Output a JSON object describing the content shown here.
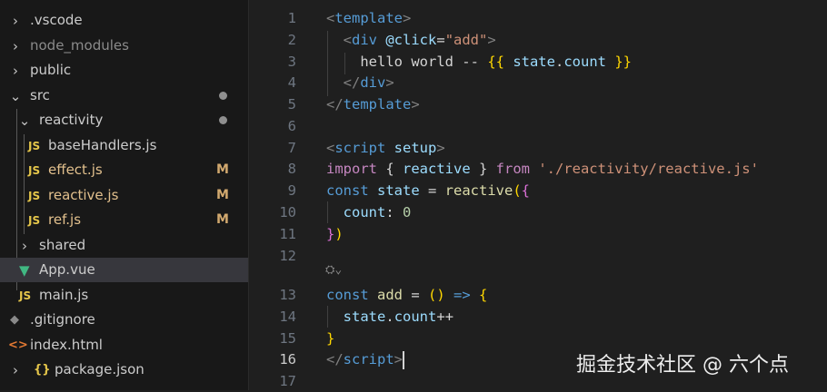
{
  "explorer": {
    "items": [
      {
        "label": ".vscode",
        "chevron": "›",
        "icon": ""
      },
      {
        "label": "node_modules",
        "chevron": "›",
        "icon": ""
      },
      {
        "label": "public",
        "chevron": "›",
        "icon": ""
      },
      {
        "label": "src",
        "chevron": "⌄",
        "icon": ""
      },
      {
        "label": "reactivity",
        "chevron": "⌄",
        "icon": ""
      },
      {
        "label": "baseHandlers.js",
        "icon": "JS"
      },
      {
        "label": "effect.js",
        "icon": "JS",
        "badge": "M"
      },
      {
        "label": "reactive.js",
        "icon": "JS",
        "badge": "M"
      },
      {
        "label": "ref.js",
        "icon": "JS",
        "badge": "M"
      },
      {
        "label": "shared",
        "chevron": "›",
        "icon": ""
      },
      {
        "label": "App.vue",
        "icon": "▼"
      },
      {
        "label": "main.js",
        "icon": "JS"
      },
      {
        "label": ".gitignore",
        "icon": "◆"
      },
      {
        "label": "index.html",
        "icon": "<>"
      },
      {
        "label": "package.json",
        "chevron": "›",
        "icon": "{}"
      }
    ]
  },
  "editor": {
    "line_numbers": [
      "1",
      "2",
      "3",
      "4",
      "5",
      "6",
      "7",
      "8",
      "9",
      "10",
      "11",
      "12",
      "13",
      "14",
      "15",
      "16",
      "17"
    ],
    "active_line": "16",
    "codelens": "⛭⌄",
    "lines": {
      "l1": {
        "a": "<",
        "b": "template",
        "c": ">"
      },
      "l2": {
        "a": "<",
        "b": "div",
        "c": " @click",
        "d": "=",
        "e": "\"add\"",
        "f": ">"
      },
      "l3": {
        "a": "hello world -- ",
        "b": "{{",
        "c": " state",
        "d": ".",
        "e": "count",
        "f": " }}"
      },
      "l4": {
        "a": "</",
        "b": "div",
        "c": ">"
      },
      "l5": {
        "a": "</",
        "b": "template",
        "c": ">"
      },
      "l7": {
        "a": "<",
        "b": "script",
        "c": " setup",
        "d": ">"
      },
      "l8": {
        "a": "import",
        "b": " { ",
        "c": "reactive",
        "d": " } ",
        "e": "from",
        "f": " './reactivity/reactive.js'"
      },
      "l9": {
        "a": "const",
        "b": " state",
        "c": " = ",
        "d": "reactive",
        "e": "(",
        "f": "{"
      },
      "l10": {
        "a": "count",
        "b": ": ",
        "c": "0"
      },
      "l11": {
        "a": "}",
        "b": ")"
      },
      "l13": {
        "a": "const",
        "b": " add",
        "c": " = ",
        "d": "()",
        "e": " => ",
        "f": "{"
      },
      "l14": {
        "a": "state",
        "b": ".",
        "c": "count",
        "d": "++"
      },
      "l15": {
        "a": "}"
      },
      "l16": {
        "a": "</",
        "b": "script",
        "c": ">"
      }
    }
  },
  "watermark": "掘金技术社区 @ 六个点"
}
